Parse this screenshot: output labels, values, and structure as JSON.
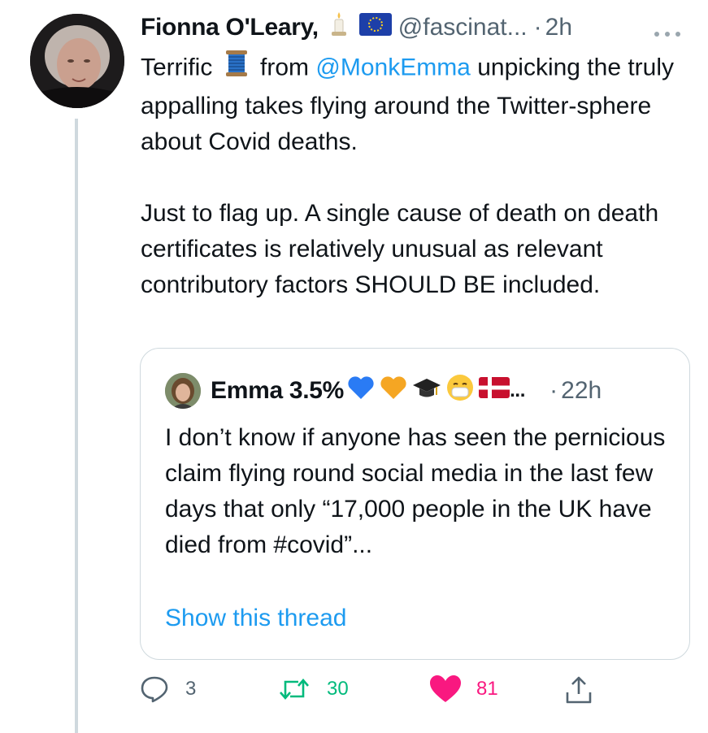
{
  "tweet": {
    "author_name": "Fionna O'Leary,",
    "handle": "@fascinat...",
    "time": "2h",
    "text_part1": "Terrific",
    "text_part2": "from",
    "mention": "@MonkEmma",
    "text_part3": "unpicking the truly appalling takes flying around the Twitter-sphere about Covid deaths.",
    "paragraph2": "Just to flag up.  A single cause of death on death certificates is relatively unusual as relevant contributory factors SHOULD BE included.",
    "icons": [
      "candle-emoji",
      "eu-flag-emoji",
      "thread-spool-emoji",
      "more-icon"
    ]
  },
  "quote": {
    "author_name": "Emma 3.5%",
    "name_suffix": "...",
    "time": "22h",
    "text": "I don’t know if anyone has seen the pernicious claim flying round social media in the last few days that only “17,000 people in the UK have died from #covid”...",
    "show_thread": "Show this thread",
    "icons": [
      "blue-heart-emoji",
      "orange-heart-emoji",
      "graduation-cap-emoji",
      "mask-face-emoji",
      "denmark-flag-emoji"
    ]
  },
  "actions": {
    "replies": "3",
    "retweets": "30",
    "likes": "81",
    "icons": [
      "reply-icon",
      "retweet-icon",
      "heart-icon",
      "share-icon"
    ],
    "colors": {
      "retweet": "#00ba7c",
      "like": "#f91880",
      "muted": "#536471",
      "link": "#1d9bf0"
    }
  }
}
